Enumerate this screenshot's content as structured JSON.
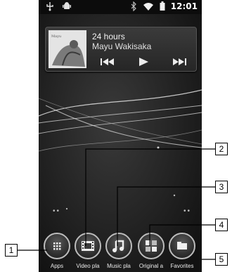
{
  "status_bar": {
    "time": "12:01",
    "icons": [
      "usb-icon",
      "android-debug-icon",
      "bluetooth-icon",
      "wifi-icon",
      "battery-icon"
    ]
  },
  "music_widget": {
    "title": "24 hours",
    "artist": "Mayu Wakisaka",
    "controls": [
      "previous-icon",
      "play-icon",
      "next-icon"
    ]
  },
  "dock": {
    "items": [
      {
        "label": "Apps",
        "icon": "apps-grid-icon"
      },
      {
        "label": "Video pla",
        "icon": "film-icon"
      },
      {
        "label": "Music pla",
        "icon": "music-note-icon"
      },
      {
        "label": "Original a",
        "icon": "squares-icon"
      },
      {
        "label": "Favorites",
        "icon": "folder-icon"
      }
    ]
  },
  "callouts": [
    "1",
    "2",
    "3",
    "4",
    "5"
  ]
}
